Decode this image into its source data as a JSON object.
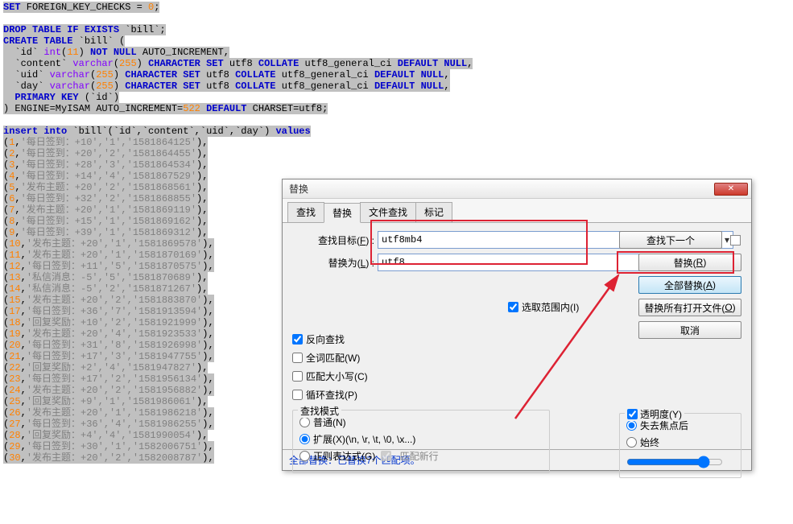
{
  "code_html": "<span class='sel'><span class='kw'>SET</span> FOREIGN_KEY_CHECKS = <span class='nm'>0</span>;</span>\n\n<span class='sel'><span class='kw'>DROP</span> <span class='kw'>TABLE</span> <span class='kw'>IF</span> <span class='kw'>EXISTS</span> `bill`;</span>\n<span class='sel'><span class='kw'>CREATE</span> <span class='kw'>TABLE</span> `bill` (</span>\n<span class='sel'>  `id` <span class='ty'>int</span>(<span class='nm'>11</span>) <span class='kw'>NOT</span> <span class='kw'>NULL</span> AUTO_INCREMENT,</span>\n<span class='sel'>  `content` <span class='ty'>varchar</span>(<span class='nm'>255</span>) <span class='kw'>CHARACTER SET</span> utf8 <span class='kw'>COLLATE</span> utf8_general_ci <span class='kw'>DEFAULT</span> <span class='kw'>NULL</span>,</span>\n<span class='sel'>  `uid` <span class='ty'>varchar</span>(<span class='nm'>255</span>) <span class='kw'>CHARACTER SET</span> utf8 <span class='kw'>COLLATE</span> utf8_general_ci <span class='kw'>DEFAULT</span> <span class='kw'>NULL</span>,</span>\n<span class='sel'>  `day` <span class='ty'>varchar</span>(<span class='nm'>255</span>) <span class='kw'>CHARACTER SET</span> utf8 <span class='kw'>COLLATE</span> utf8_general_ci <span class='kw'>DEFAULT</span> <span class='kw'>NULL</span>,</span>\n<span class='sel'>  <span class='kw'>PRIMARY KEY</span> (`id`)</span>\n<span class='sel'>) ENGINE=MyISAM AUTO_INCREMENT=<span class='nm'>522</span> <span class='kw'>DEFAULT</span> CHARSET=utf8;</span>\n\n<span class='sel'><span class='kw'>insert</span> <span class='kw'>into</span> `bill`(`id`,`content`,`uid`,`day`) <span class='kw'>values</span></span>\n<span class='sel'>(<span class='nm'>1</span>,<span class='grey'>'每日签到：+10','1','1581864125'</span>),</span>\n<span class='sel'>(<span class='nm'>2</span>,<span class='grey'>'每日签到：+20','2','1581864455'</span>),</span>\n<span class='sel'>(<span class='nm'>3</span>,<span class='grey'>'每日签到：+28','3','1581864534'</span>),</span>\n<span class='sel'>(<span class='nm'>4</span>,<span class='grey'>'每日签到：+14','4','1581867529'</span>),</span>\n<span class='sel'>(<span class='nm'>5</span>,<span class='grey'>'发布主题：+20','2','1581868561'</span>),</span>\n<span class='sel'>(<span class='nm'>6</span>,<span class='grey'>'每日签到：+32','2','1581868855'</span>),</span>\n<span class='sel'>(<span class='nm'>7</span>,<span class='grey'>'发布主题：+20','1','1581869119'</span>),</span>\n<span class='sel'>(<span class='nm'>8</span>,<span class='grey'>'每日签到：+15','1','1581869162'</span>),</span>\n<span class='sel'>(<span class='nm'>9</span>,<span class='grey'>'每日签到：+39','1','1581869312'</span>),</span>\n<span class='sel'>(<span class='nm'>10</span>,<span class='grey'>'发布主题：+20','1','1581869578'</span>),</span>\n<span class='sel'>(<span class='nm'>11</span>,<span class='grey'>'发布主题：+20','1','1581870169'</span>),</span>\n<span class='sel'>(<span class='nm'>12</span>,<span class='grey'>'每日签到：+11','5','1581870575'</span>),</span>\n<span class='sel'>(<span class='nm'>13</span>,<span class='grey'>'私信消息：-5','5','1581870689'</span>),</span>\n<span class='sel'>(<span class='nm'>14</span>,<span class='grey'>'私信消息：-5','2','1581871267'</span>),</span>\n<span class='sel'>(<span class='nm'>15</span>,<span class='grey'>'发布主题：+20','2','1581883870'</span>),</span>\n<span class='sel'>(<span class='nm'>17</span>,<span class='grey'>'每日签到：+36','7','1581913594'</span>),</span>\n<span class='sel'>(<span class='nm'>18</span>,<span class='grey'>'回复奖励：+10','2','1581921999'</span>),</span>\n<span class='sel'>(<span class='nm'>19</span>,<span class='grey'>'发布主题：+20','4','1581923533'</span>),</span>\n<span class='sel'>(<span class='nm'>20</span>,<span class='grey'>'每日签到：+31','8','1581926998'</span>),</span>\n<span class='sel'>(<span class='nm'>21</span>,<span class='grey'>'每日签到：+17','3','1581947755'</span>),</span>\n<span class='sel'>(<span class='nm'>22</span>,<span class='grey'>'回复奖励：+2','4','1581947827'</span>),</span>\n<span class='sel'>(<span class='nm'>23</span>,<span class='grey'>'每日签到：+17','2','1581956134'</span>),</span>\n<span class='sel'>(<span class='nm'>24</span>,<span class='grey'>'发布主题：+20','2','1581956882'</span>),</span>\n<span class='sel'>(<span class='nm'>25</span>,<span class='grey'>'回复奖励：+9','1','1581986061'</span>),</span>\n<span class='sel'>(<span class='nm'>26</span>,<span class='grey'>'发布主题：+20','1','1581986218'</span>),</span>\n<span class='sel'>(<span class='nm'>27</span>,<span class='grey'>'每日签到：+36','4','1581986255'</span>),</span>\n<span class='sel'>(<span class='nm'>28</span>,<span class='grey'>'回复奖励：+4','4','1581990054'</span>),</span>\n<span class='sel'>(<span class='nm'>29</span>,<span class='grey'>'每日签到：+30','1','1582006751'</span>),</span>\n<span class='sel'>(<span class='nm'>30</span>,<span class='grey'>'发布主题：+20','2','1582008787'</span>),</span>",
  "dialog": {
    "title": "替换",
    "tabs": {
      "find": "查找",
      "replace": "替换",
      "findinfiles": "文件查找",
      "mark": "标记"
    },
    "labels": {
      "find_target_pre": "查找目标(",
      "find_target_ul": "F",
      "find_target_post": ") :",
      "replace_with_pre": "替换为(",
      "replace_with_ul": "L",
      "replace_with_post": ") :"
    },
    "inputs": {
      "find": "utf8mb4",
      "replace": "utf8"
    },
    "opts": {
      "in_selection_pre": "选取范围内(",
      "in_selection_ul": "I",
      "in_selection_post": ")",
      "backward_pre": "反向查找",
      "backward_ul": "",
      "backward_post": "",
      "whole_word_pre": "全词匹配(",
      "whole_word_ul": "W",
      "whole_word_post": ")",
      "match_case_pre": "匹配大小写(",
      "match_case_ul": "C",
      "match_case_post": ")",
      "wrap_pre": "循环查找(",
      "wrap_ul": "P",
      "wrap_post": ")"
    },
    "mode": {
      "title": "查找模式",
      "normal_pre": "普通(",
      "normal_ul": "N",
      "normal_post": ")",
      "extended_pre": "扩展(",
      "extended_ul": "X",
      "extended_post": ") ",
      "extended_hint": "(\\n, \\r, \\t, \\0, \\x...)",
      "regex_pre": "正则表达式(",
      "regex_ul": "G",
      "regex_post": ")",
      "dotnl": ". 匹配新行"
    },
    "trans": {
      "title_pre": "透明度(",
      "title_ul": "Y",
      "title_post": ")",
      "on_blur": "失去焦点后",
      "always": "始终"
    },
    "buttons": {
      "find_next": "查找下一个",
      "replace_pre": "替换(",
      "replace_ul": "R",
      "replace_post": ")",
      "replace_all_pre": "全部替换(",
      "replace_all_ul": "A",
      "replace_all_post": ")",
      "replace_open_pre": "替换所有打开文件(",
      "replace_open_ul": "O",
      "replace_open_post": ")",
      "cancel": "取消"
    },
    "status": "全部替换：已替换7个匹配项。"
  }
}
